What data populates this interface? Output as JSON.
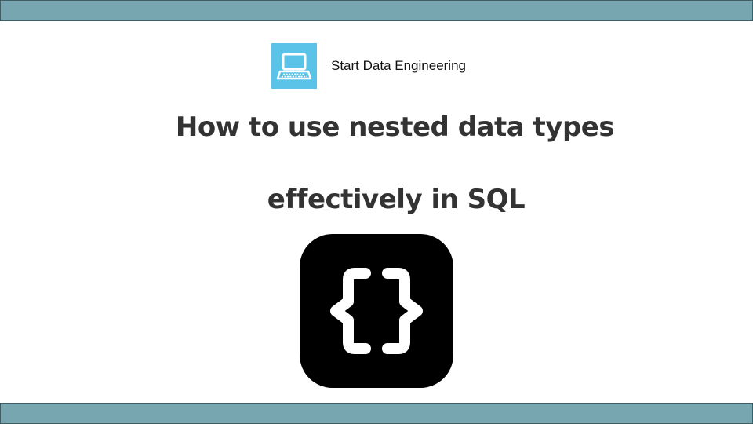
{
  "header": {
    "brand_name": "Start Data Engineering",
    "logo_icon": "laptop-icon",
    "logo_color": "#5bc3e7"
  },
  "slide": {
    "title_line_1": "How to use nested data types",
    "title_line_2": "effectively in SQL",
    "main_icon": "curly-braces-icon"
  },
  "theme": {
    "band_color": "#77a6b0",
    "title_color": "#333333"
  }
}
